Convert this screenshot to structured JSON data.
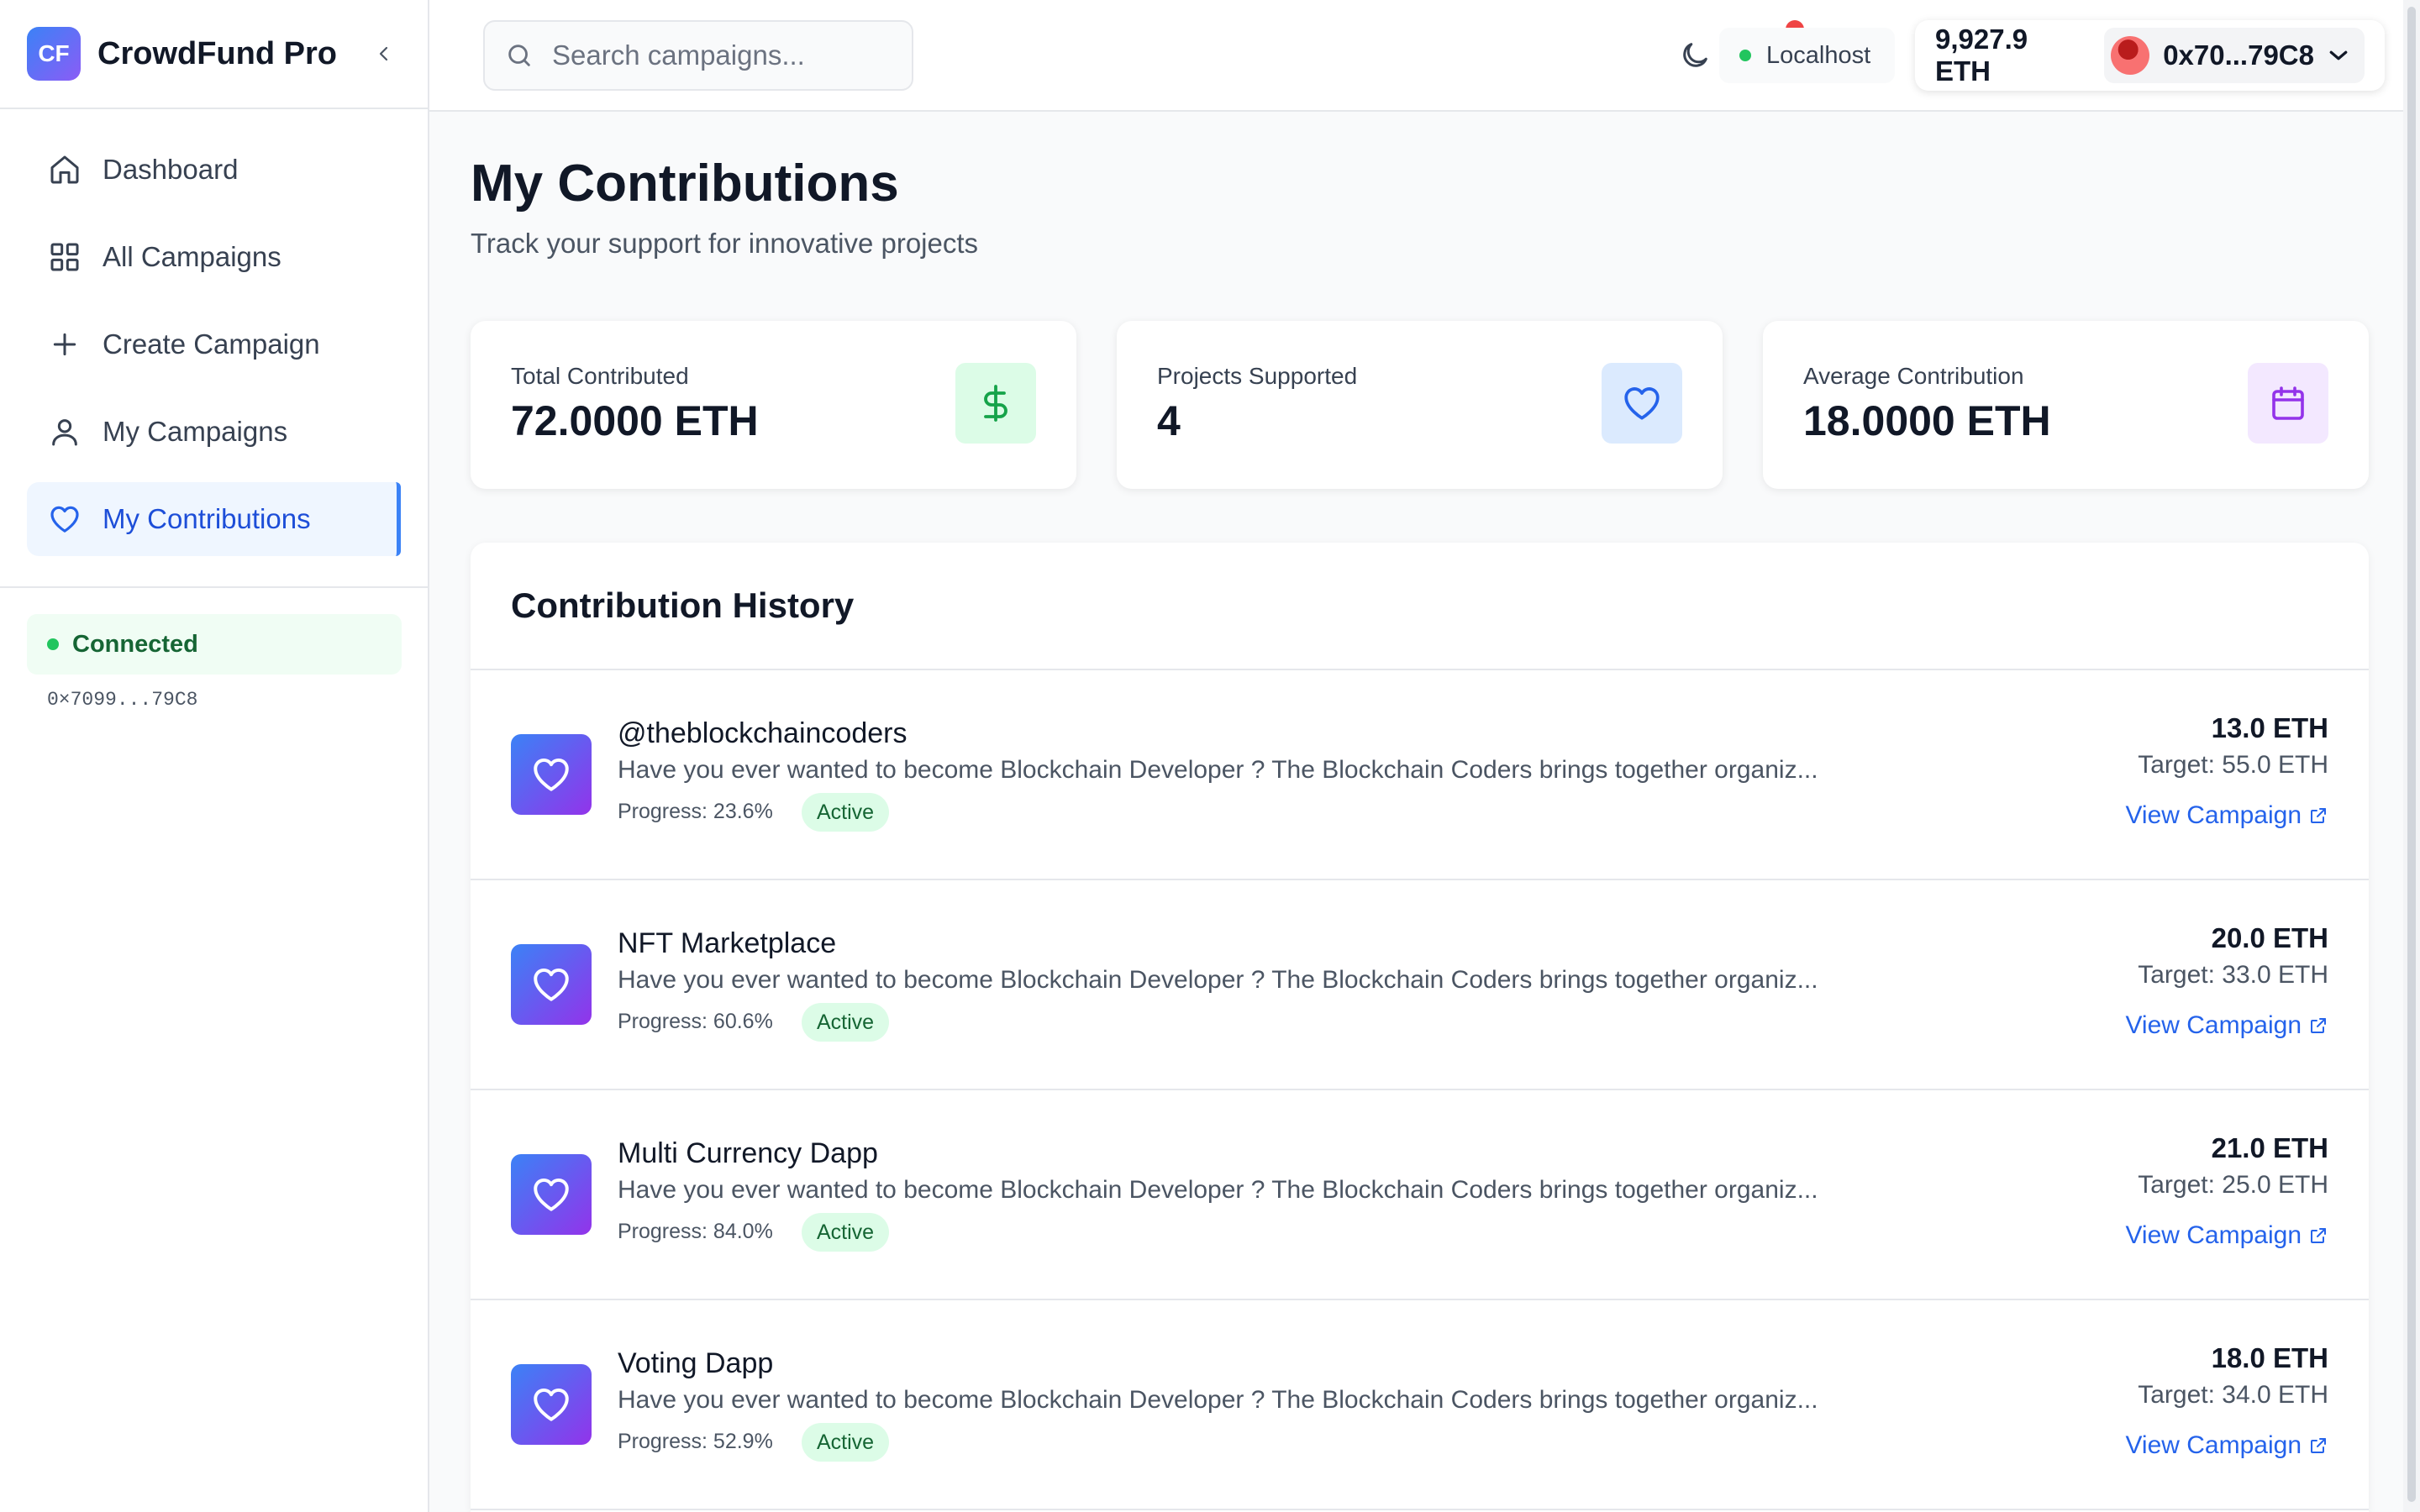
{
  "app": {
    "logo_text": "CF",
    "name": "CrowdFund Pro"
  },
  "sidebar": {
    "items": [
      {
        "label": "Dashboard",
        "icon": "home-icon",
        "active": false
      },
      {
        "label": "All Campaigns",
        "icon": "grid-icon",
        "active": false
      },
      {
        "label": "Create Campaign",
        "icon": "plus-icon",
        "active": false
      },
      {
        "label": "My Campaigns",
        "icon": "user-icon",
        "active": false
      },
      {
        "label": "My Contributions",
        "icon": "heart-icon",
        "active": true
      }
    ],
    "connection": {
      "status": "Connected",
      "address": "0×7099...79C8"
    }
  },
  "header": {
    "search_placeholder": "Search campaigns...",
    "network": "Localhost",
    "balance": "9,927.9 ETH",
    "account": "0x70...79C8"
  },
  "page": {
    "title": "My Contributions",
    "subtitle": "Track your support for innovative projects"
  },
  "stats": [
    {
      "label": "Total Contributed",
      "value": "72.0000 ETH",
      "icon": "dollar-icon",
      "color": "#16a34a",
      "bg": "#dcfce7"
    },
    {
      "label": "Projects Supported",
      "value": "4",
      "icon": "heart-icon",
      "color": "#2563eb",
      "bg": "#dbeafe"
    },
    {
      "label": "Average Contribution",
      "value": "18.0000 ETH",
      "icon": "calendar-icon",
      "color": "#9333ea",
      "bg": "#f3e8ff"
    }
  ],
  "history": {
    "title": "Contribution History",
    "rows": [
      {
        "name": "@theblockchaincoders",
        "description": "Have you ever wanted to become Blockchain Developer ? The Blockchain Coders brings together organiz...",
        "progress": "Progress: 23.6%",
        "status": "Active",
        "amount": "13.0 ETH",
        "target": "Target: 55.0 ETH",
        "link": "View Campaign"
      },
      {
        "name": "NFT Marketplace",
        "description": "Have you ever wanted to become Blockchain Developer ? The Blockchain Coders brings together organiz...",
        "progress": "Progress: 60.6%",
        "status": "Active",
        "amount": "20.0 ETH",
        "target": "Target: 33.0 ETH",
        "link": "View Campaign"
      },
      {
        "name": "Multi Currency Dapp",
        "description": "Have you ever wanted to become Blockchain Developer ? The Blockchain Coders brings together organiz...",
        "progress": "Progress: 84.0%",
        "status": "Active",
        "amount": "21.0 ETH",
        "target": "Target: 25.0 ETH",
        "link": "View Campaign"
      },
      {
        "name": "Voting Dapp",
        "description": "Have you ever wanted to become Blockchain Developer ? The Blockchain Coders brings together organiz...",
        "progress": "Progress: 52.9%",
        "status": "Active",
        "amount": "18.0 ETH",
        "target": "Target: 34.0 ETH",
        "link": "View Campaign"
      }
    ]
  },
  "colors": {
    "accent": "#2563eb",
    "brand_gradient_start": "#3b82f6",
    "brand_gradient_end": "#8b5cf6",
    "success": "#22c55e",
    "notification": "#ef4444"
  }
}
